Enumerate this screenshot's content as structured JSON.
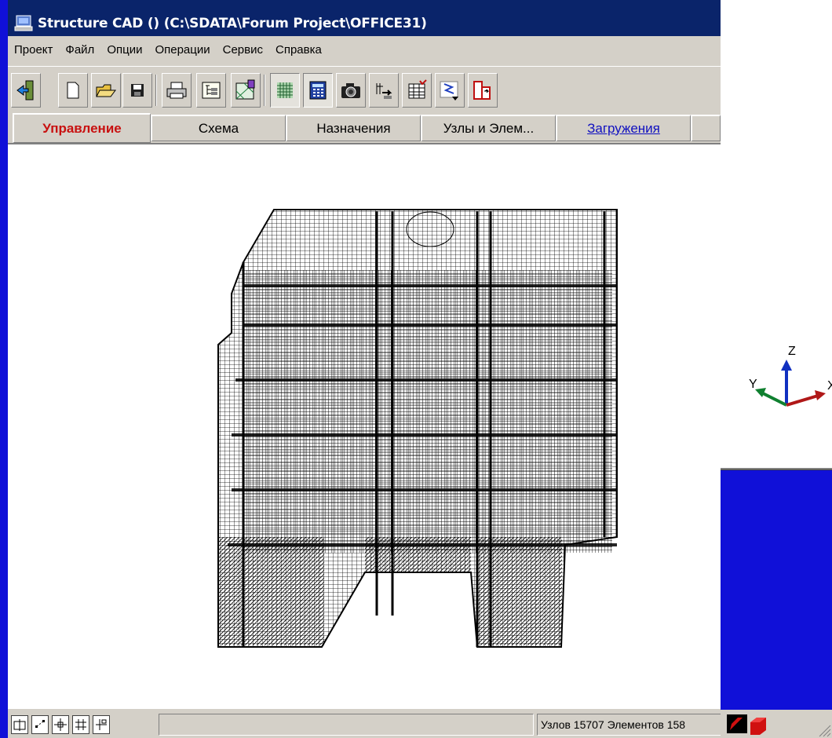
{
  "window": {
    "title": "Structure CAD () (C:\\SDATA\\Forum Project\\OFFICE31)"
  },
  "menu": [
    {
      "label": "Проект"
    },
    {
      "label": "Файл"
    },
    {
      "label": "Опции"
    },
    {
      "label": "Операции"
    },
    {
      "label": "Сервис"
    },
    {
      "label": "Справка"
    }
  ],
  "toolbar": {
    "icons": [
      "exit-icon",
      "new-file-icon",
      "open-folder-icon",
      "save-icon",
      "print-icon",
      "tree-icon",
      "paint-icon",
      "mesh-icon",
      "calculator-icon",
      "camera-icon",
      "renumber-icon",
      "table-icon",
      "lightning-icon",
      "report-icon"
    ]
  },
  "tabs": [
    {
      "label": "Управление",
      "state": "active"
    },
    {
      "label": "Схема",
      "state": "normal"
    },
    {
      "label": "Назначения",
      "state": "normal"
    },
    {
      "label": "Узлы и Элем...",
      "state": "normal"
    },
    {
      "label": "Загружения",
      "state": "link"
    }
  ],
  "axes": {
    "z": "Z",
    "y": "Y",
    "x": "X",
    "colors": {
      "z": "#1030c0",
      "y": "#108030",
      "x": "#b01818"
    }
  },
  "status": {
    "nodes_text": "Узлов 15707 Элементов 158",
    "left_buttons": [
      "view-front-icon",
      "view-nodes-icon",
      "view-center-icon",
      "view-grid-icon",
      "view-split-icon"
    ]
  },
  "colors": {
    "desktop": "#1010d8",
    "title_bar": "#0a246a",
    "chrome": "#d4d0c8",
    "active_tab": "#c81010",
    "link_tab": "#1010c0"
  }
}
